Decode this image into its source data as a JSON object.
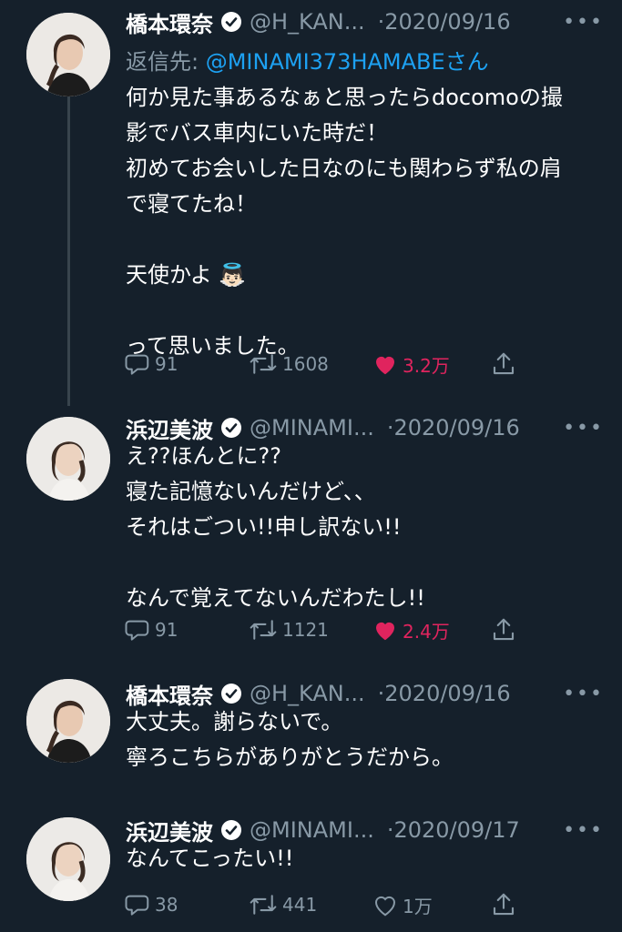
{
  "tweets": [
    {
      "name": "橋本環奈",
      "handle": "@H_KAN...",
      "separator": "·",
      "date": "2020/09/16",
      "more": "•••",
      "reply_label": "返信先: ",
      "reply_mention": "@MINAMI373HAMABEさん",
      "text": "何か見た事あるなぁと思ったらdocomoの撮\n影でバス車内にいた時だ！\n初めてお会いした日なのにも関わらず私の肩\nで寝てたね！\n\n天使かよ 👼🏻\n\nって思いました。",
      "replies": "91",
      "retweets": "1608",
      "likes": "3.2万",
      "liked": true
    },
    {
      "name": "浜辺美波",
      "handle": "@MINAMI...",
      "separator": "·",
      "date": "2020/09/16",
      "more": "•••",
      "text": "え??ほんとに??\n寝た記憶ないんだけど、、\nそれはごつい!!申し訳ない!!\n\nなんで覚えてないんだわたし!!",
      "replies": "91",
      "retweets": "1121",
      "likes": "2.4万",
      "liked": true
    },
    {
      "name": "橋本環奈",
      "handle": "@H_KAN...",
      "separator": "·",
      "date": "2020/09/16",
      "more": "•••",
      "text": "大丈夫。謝らないで。\n寧ろこちらがありがとうだから。"
    },
    {
      "name": "浜辺美波",
      "handle": "@MINAMI...",
      "separator": "·",
      "date": "2020/09/17",
      "more": "•••",
      "text": "なんてこったい!!",
      "replies": "38",
      "retweets": "441",
      "likes": "1万",
      "liked": false
    }
  ],
  "colors": {
    "background": "#15202b",
    "muted": "#8899a6",
    "link": "#1da1f2",
    "like": "#e0245e",
    "thread_line": "#38444d"
  },
  "icons": [
    "verified-badge-icon",
    "reply-icon",
    "retweet-icon",
    "heart-icon",
    "share-icon",
    "more-icon"
  ]
}
